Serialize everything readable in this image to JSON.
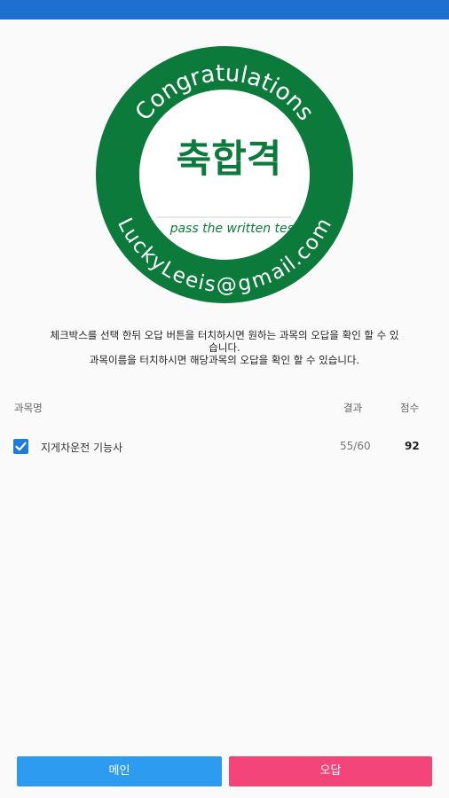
{
  "seal": {
    "arc_top_text": "Congratulations",
    "arc_bottom_text": "LuckyLeeis@gmail.com",
    "center_text": "축합격",
    "sub_text": "pass the written test",
    "colors": {
      "ring": "#0b7a3a",
      "center_text": "#0b7a3a"
    }
  },
  "instructions": {
    "line1": "체크박스를 선택 한뒤 오답 버튼을 터치하시면 원하는 과목의 오답을 확인 할 수 있",
    "line2": "습니다.",
    "line3": "과목이름을 터치하시면 해당과목의 오답을 확인 할 수 있습니다."
  },
  "table": {
    "headers": {
      "subject": "과목명",
      "result": "결과",
      "score": "점수"
    },
    "rows": [
      {
        "checked": true,
        "subject": "지게차운전 기능사",
        "result": "55/60",
        "score": "92"
      }
    ]
  },
  "buttons": {
    "main": "메인",
    "wrong_answers": "오답"
  },
  "colors": {
    "status_bar": "#1e6fcf",
    "main_button": "#2d9bef",
    "wrong_button": "#f4457a",
    "checkbox": "#1e7be0"
  }
}
